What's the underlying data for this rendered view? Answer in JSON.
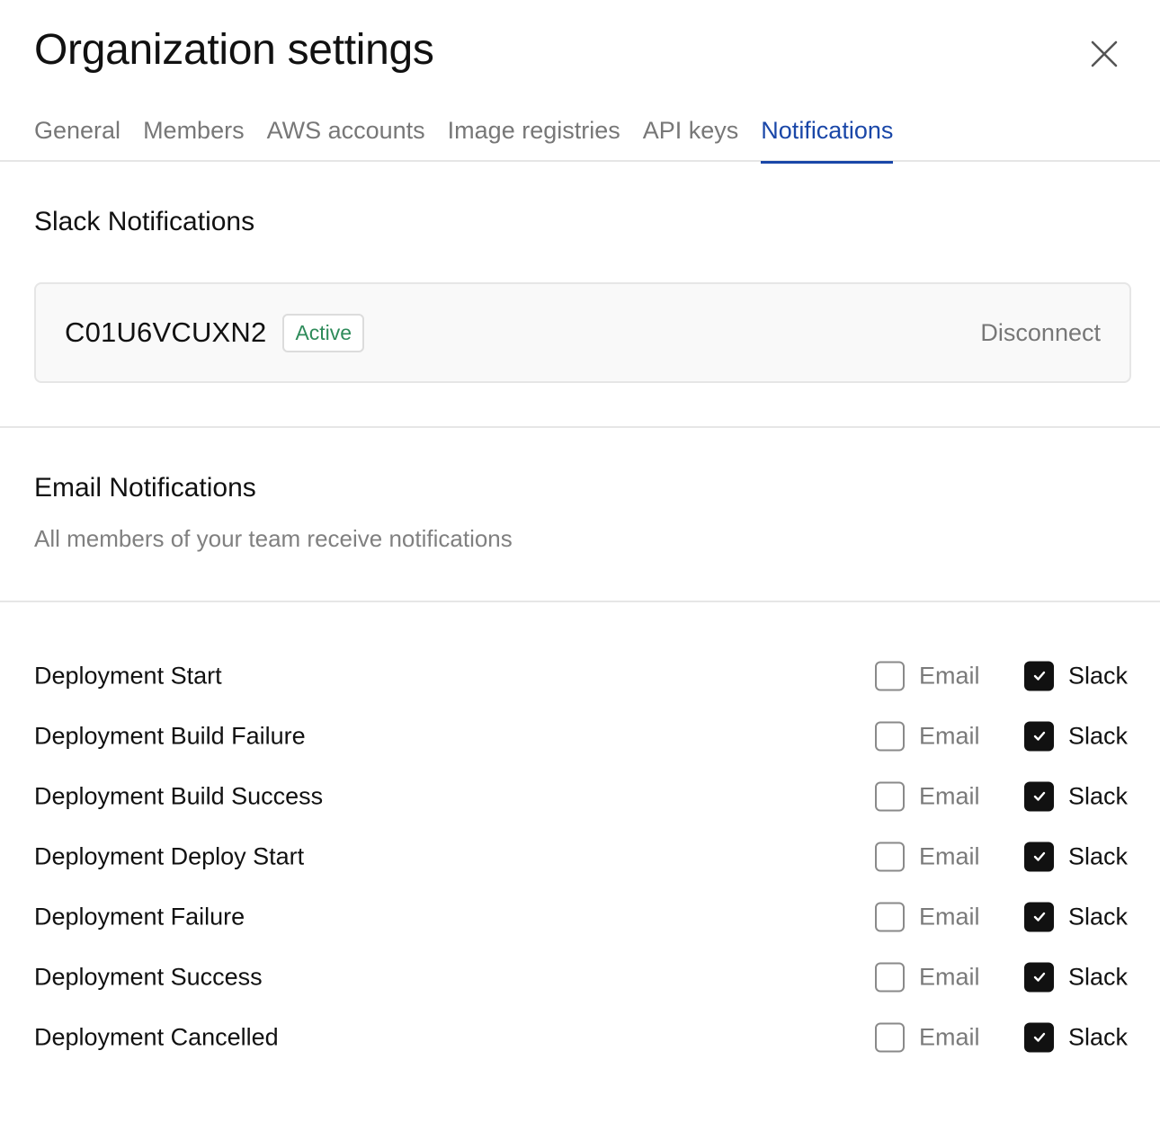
{
  "dialog": {
    "title": "Organization settings",
    "close_icon": "close-icon"
  },
  "tabs": [
    {
      "label": "General",
      "active": false
    },
    {
      "label": "Members",
      "active": false
    },
    {
      "label": "AWS accounts",
      "active": false
    },
    {
      "label": "Image registries",
      "active": false
    },
    {
      "label": "API keys",
      "active": false
    },
    {
      "label": "Notifications",
      "active": true
    }
  ],
  "slack": {
    "title": "Slack Notifications",
    "channel_id": "C01U6VCUXN2",
    "status": "Active",
    "disconnect_label": "Disconnect"
  },
  "email": {
    "title": "Email Notifications",
    "subtitle": "All members of your team receive notifications"
  },
  "events": [
    {
      "label": "Deployment Start",
      "email_label": "Email",
      "email": false,
      "slack_label": "Slack",
      "slack": true
    },
    {
      "label": "Deployment Build Failure",
      "email_label": "Email",
      "email": false,
      "slack_label": "Slack",
      "slack": true
    },
    {
      "label": "Deployment Build Success",
      "email_label": "Email",
      "email": false,
      "slack_label": "Slack",
      "slack": true
    },
    {
      "label": "Deployment Deploy Start",
      "email_label": "Email",
      "email": false,
      "slack_label": "Slack",
      "slack": true
    },
    {
      "label": "Deployment Failure",
      "email_label": "Email",
      "email": false,
      "slack_label": "Slack",
      "slack": true
    },
    {
      "label": "Deployment Success",
      "email_label": "Email",
      "email": false,
      "slack_label": "Slack",
      "slack": true
    },
    {
      "label": "Deployment Cancelled",
      "email_label": "Email",
      "email": false,
      "slack_label": "Slack",
      "slack": true
    }
  ],
  "colors": {
    "accent": "#1a47a8",
    "active_badge": "#2e8b5a",
    "checkbox_checked": "#111111"
  }
}
